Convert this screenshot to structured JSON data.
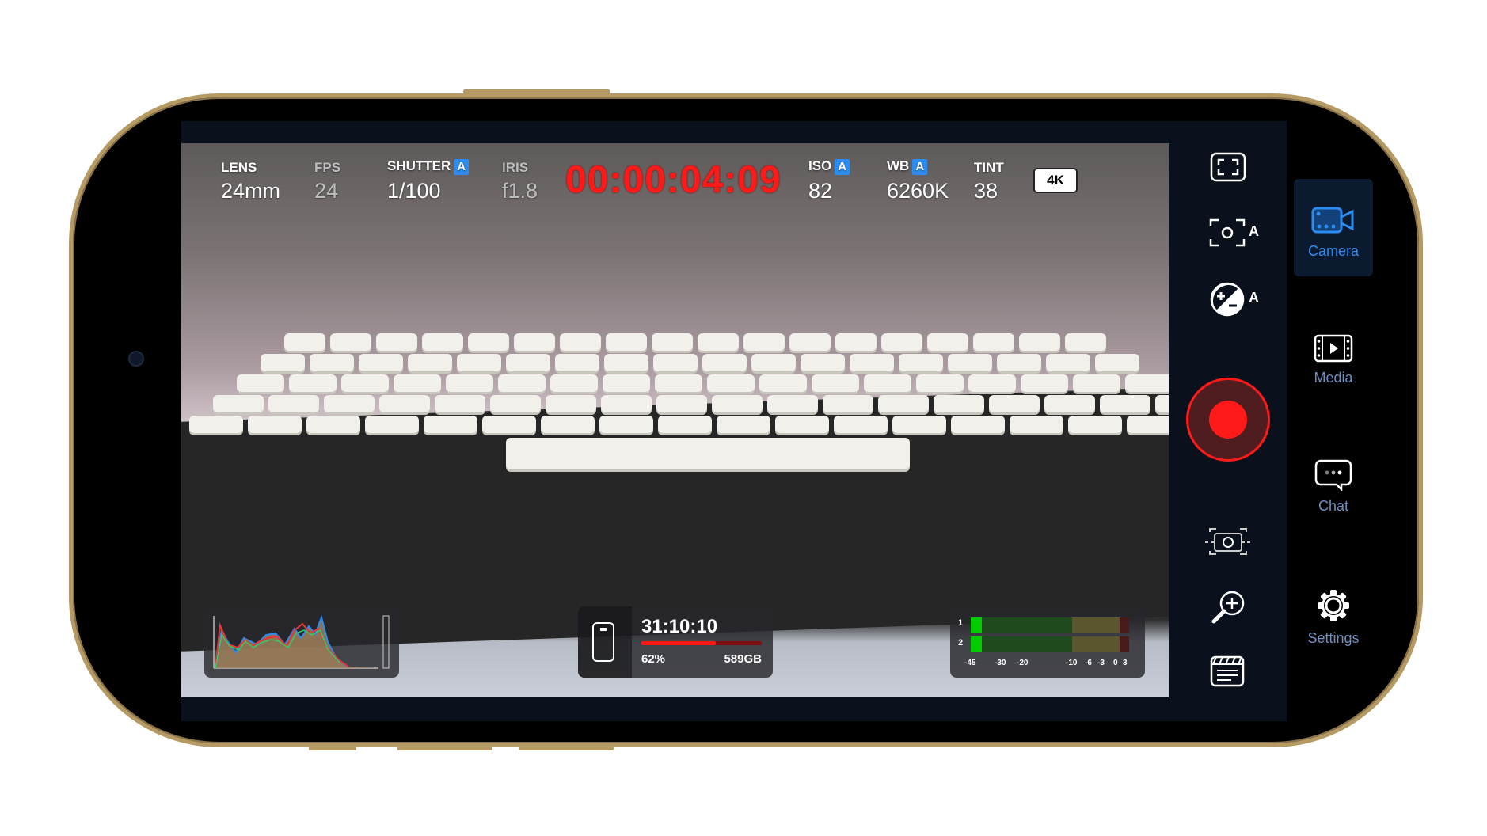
{
  "readouts": {
    "lens": {
      "label": "LENS",
      "value": "24mm"
    },
    "fps": {
      "label": "FPS",
      "value": "24"
    },
    "shutter": {
      "label": "SHUTTER",
      "auto": "A",
      "value": "1/100"
    },
    "iris": {
      "label": "IRIS",
      "value": "f1.8"
    },
    "timecode": "00:00:04:09",
    "iso": {
      "label": "ISO",
      "auto": "A",
      "value": "82"
    },
    "wb": {
      "label": "WB",
      "auto": "A",
      "value": "6260K"
    },
    "tint": {
      "label": "TINT",
      "value": "38"
    },
    "resolution": "4K"
  },
  "storage": {
    "remaining_time": "31:10:10",
    "percent": "62%",
    "percent_value": 62,
    "free": "589GB"
  },
  "audio": {
    "channels": [
      "1",
      "2"
    ],
    "scale": [
      "-45",
      "-30",
      "-20",
      "-10",
      "-6",
      "-3",
      "0",
      "3"
    ],
    "levels_db": [
      -42,
      -42
    ]
  },
  "controls": {
    "auto_focus_label": "A",
    "auto_exposure_label": "A"
  },
  "nav": [
    {
      "label": "Camera",
      "active": true
    },
    {
      "label": "Media"
    },
    {
      "label": "Chat"
    },
    {
      "label": "Settings"
    }
  ],
  "colors": {
    "record": "#ff1a1a",
    "accent": "#2d8cf0",
    "frame": "#b59a63"
  }
}
